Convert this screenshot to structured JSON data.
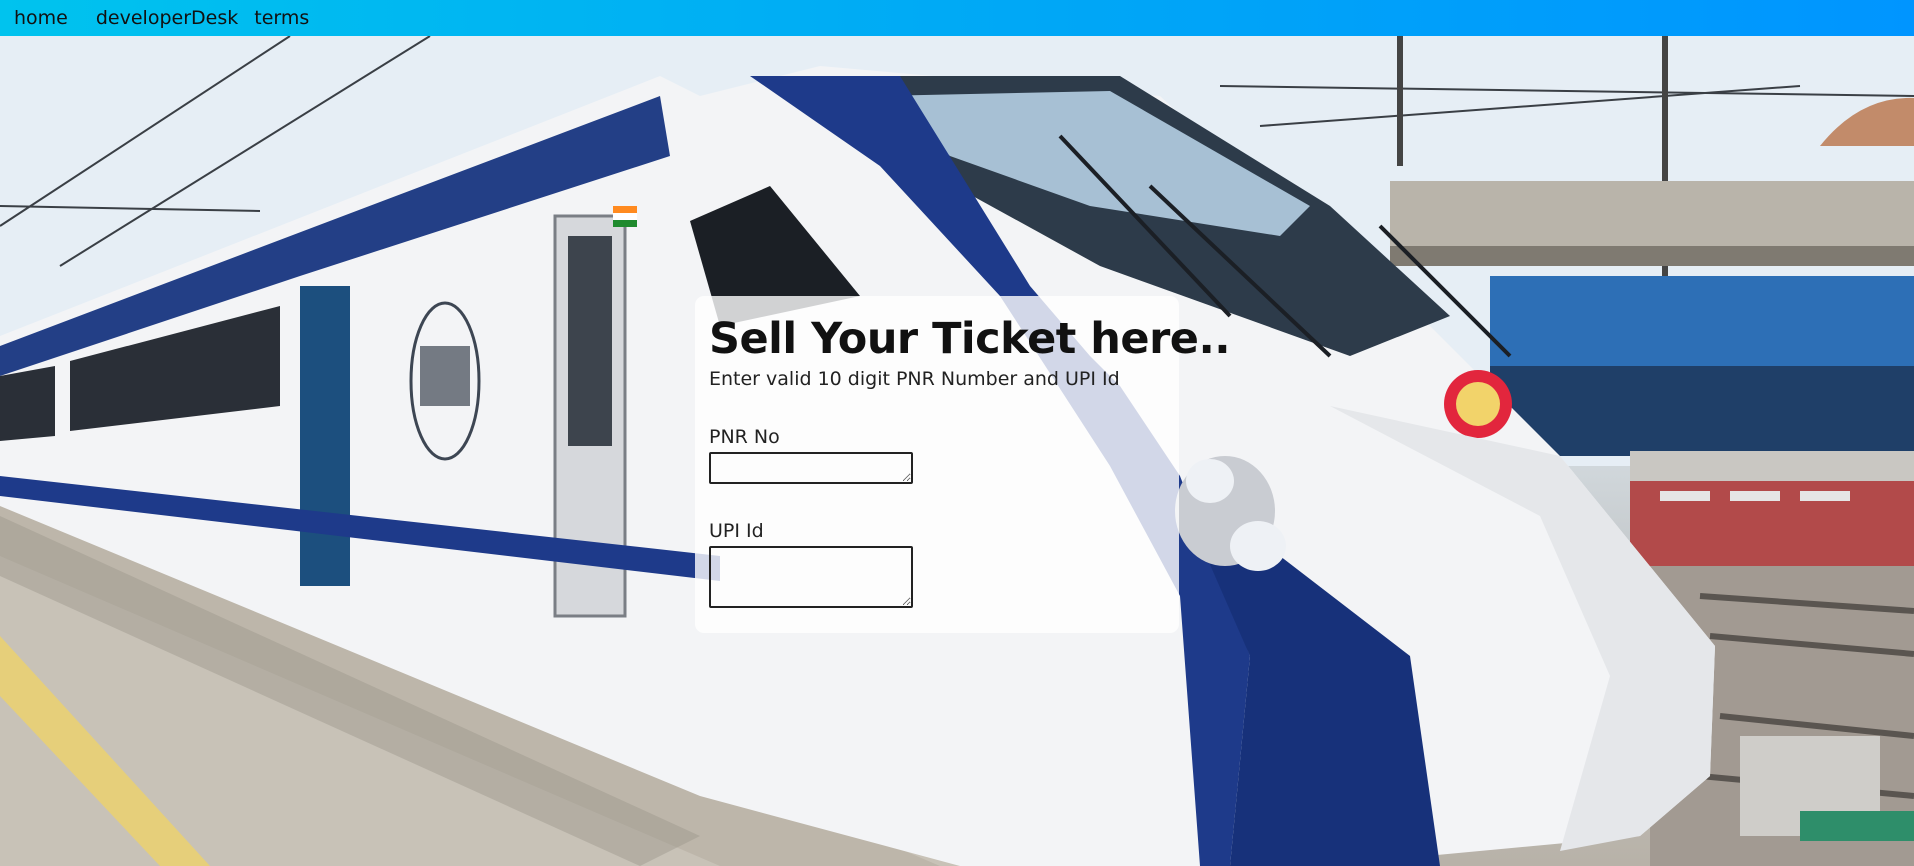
{
  "nav": {
    "items": [
      {
        "label": "home"
      },
      {
        "label": "developerDesk"
      },
      {
        "label": "terms"
      }
    ]
  },
  "form": {
    "title": "Sell Your Ticket here..",
    "subtitle": "Enter valid 10 digit PNR Number and UPI Id",
    "pnr_label": "PNR No",
    "pnr_value": "",
    "upi_label": "UPI Id",
    "upi_value": ""
  },
  "colors": {
    "navbar_start": "#00c3ee",
    "navbar_end": "#0095ff",
    "train_blue": "#1e3a8a"
  },
  "background": {
    "icon": "train-photo"
  }
}
